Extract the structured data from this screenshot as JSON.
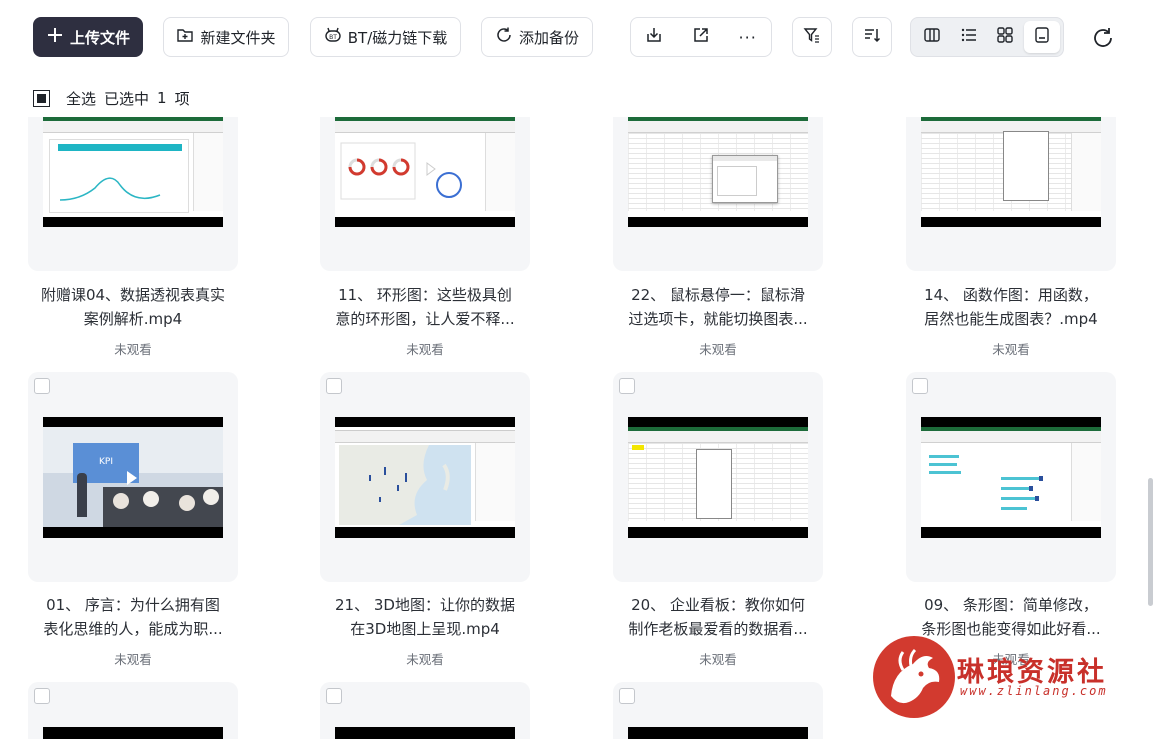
{
  "toolbar": {
    "upload_label": "上传文件",
    "new_folder_label": "新建文件夹",
    "bt_label": "BT/磁力链下载",
    "backup_label": "添加备份",
    "more_glyph": "···"
  },
  "selection": {
    "select_all_label": "全选",
    "selected_label": "已选中",
    "count": "1",
    "unit": "项"
  },
  "files": [
    {
      "title_line1": "附赠课04、数据透视表真实",
      "title_line2": "案例解析.mp4",
      "status": "未观看"
    },
    {
      "title_line1": "11、 环形图：这些极具创",
      "title_line2": "意的环形图，让人爱不释...",
      "status": "未观看"
    },
    {
      "title_line1": "22、 鼠标悬停一：鼠标滑",
      "title_line2": "过选项卡，就能切换图表...",
      "status": "未观看"
    },
    {
      "title_line1": "14、 函数作图：用函数，",
      "title_line2": "居然也能生成图表？.mp4",
      "status": "未观看"
    },
    {
      "title_line1": "01、 序言：为什么拥有图",
      "title_line2": "表化思维的人，能成为职...",
      "status": "未观看",
      "thumb_text": "KPI"
    },
    {
      "title_line1": "21、 3D地图：让你的数据",
      "title_line2": "在3D地图上呈现.mp4",
      "status": "未观看"
    },
    {
      "title_line1": "20、 企业看板：教你如何",
      "title_line2": "制作老板最爱看的数据看...",
      "status": "未观看"
    },
    {
      "title_line1": "09、 条形图：简单修改，",
      "title_line2": "条形图也能变得如此好看...",
      "status": "未观看"
    }
  ],
  "watermark": {
    "name": "琳琅资源社",
    "url": "www.zlinlang.com"
  },
  "colors": {
    "primary_button": "#2e2f40",
    "card_bg": "#f5f6f8",
    "excel_green": "#1d6b3a",
    "watermark_red": "#d23a2f"
  }
}
